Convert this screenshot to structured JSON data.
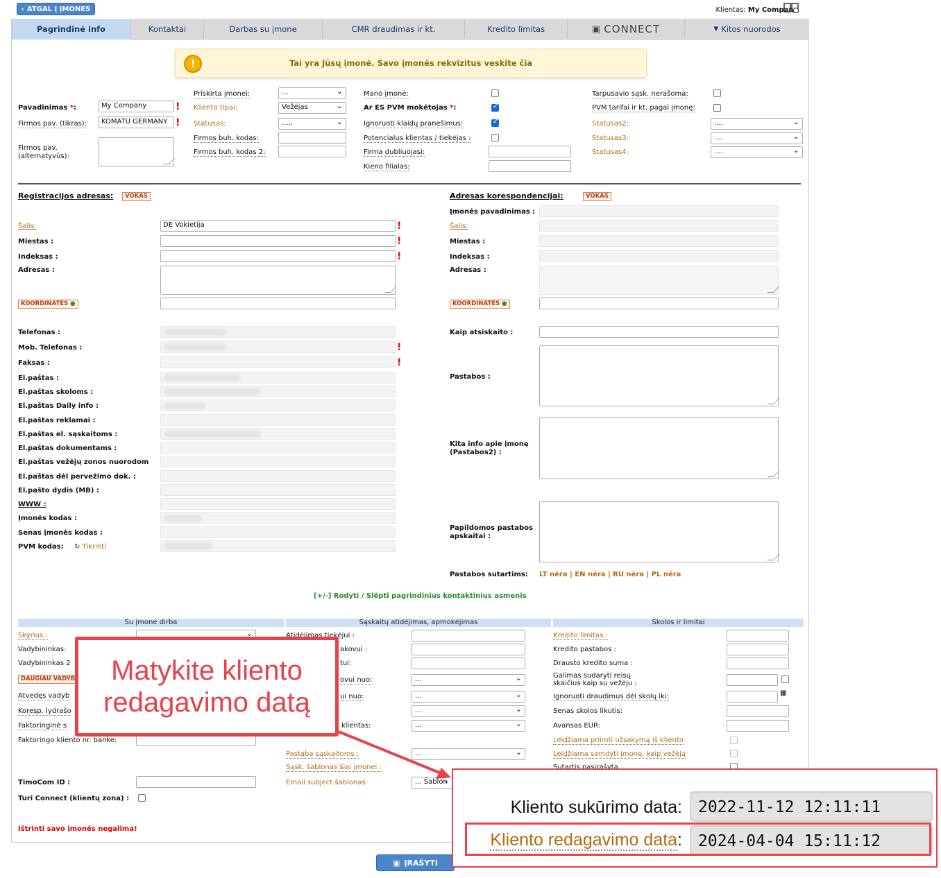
{
  "top": {
    "back_label": "ATGAL Į ĮMONES",
    "client_label": "Klientas:",
    "client_name": "My Company"
  },
  "tabs": [
    "Pagrindinė info",
    "Kontaktai",
    "Darbas su įmone",
    "CMR draudimas ir kt.",
    "Kredito limitas",
    "CONNECT",
    "Kitos nuorodos"
  ],
  "warning": "Tai yra Jūsų įmonė. Savo įmonės rekvizitus veskite čia",
  "main": {
    "pavadinimas_label": "Pavadinimas",
    "pavadinimas_value": "My Company",
    "firmos_label": "Firmos pav. (tikras):",
    "firmos_value": "KOMATU GERMANY",
    "firmos_alt_label": "Firmos pav. (alternatyvūs):",
    "priskirta_label": "Priskirta įmonei:",
    "priskirta_value": "...",
    "kliento_tipai_label": "Kliento tipai",
    "kliento_tipai_value": "Vežėjas",
    "statusas_label": "Statusas",
    "statusas_value": ".....",
    "buh_label": "Firmos buh. kodas:",
    "buh2_label": "Firmos buh. kodas 2:",
    "mano_label": "Mano įmonė:",
    "es_label": "Ar ES PVM mokėtojas",
    "ignoruoti_label": "Ignoruoti klaidų pranešimus:",
    "potencialus_label": "Potencialus klientas / tiekėjas :",
    "dubliuojasi_label": "Firma dubliuojasi:",
    "filialas_label": "Kieno filialas:",
    "tarpusavio_label": "Tarpusavio sąsk. nerašoma:",
    "pvm_tarifai_label": "PVM tarifai ir kt. pagal įmonę:",
    "statusas2_label": "Statusas2",
    "statusas3_label": "Statusas3",
    "statusas4_label": "Statusas4",
    "status_value": "...."
  },
  "reg": {
    "title": "Registracijos adresas:",
    "vokas": "VOKAS",
    "salis_label": "Šalis:",
    "salis_value": "DE Vokietija",
    "miestas_label": "Miestas :",
    "indeksas_label": "Indeksas :",
    "adresas_label": "Adresas :",
    "koord": "KOORDINATĖS",
    "telefonas": "Telefonas :",
    "mob": "Mob. Telefonas :",
    "faksas": "Faksas :",
    "el": "El.paštas :",
    "el_skol": "El.paštas skoloms :",
    "el_daily": "El.paštas Daily info :",
    "el_rekl": "El.paštas reklamai :",
    "el_sask": "El.paštas el. sąskaitoms :",
    "el_dok": "El.paštas dokumentams :",
    "el_vez": "El.paštas vežėjų zonos nuorodom",
    "el_perv": "El.paštas dėl pervežimo dok. :",
    "el_dydis": "El.pašto dydis (MB) :",
    "www": "WWW :",
    "kodas": "Įmonės kodas :",
    "senas": "Senas įmonės kodas :",
    "pvm": "PVM kodas:",
    "tikrinti": "Tikrinti"
  },
  "corr": {
    "title": "Adresas korespondencijai:",
    "vokas": "VOKAS",
    "pav": "Įmonės pavadinimas :",
    "salis": "Šalis:",
    "miestas": "Miestas :",
    "indeksas": "Indeksas :",
    "adresas": "Adresas :",
    "koord": "KOORDINATĖS",
    "atsiskaito": "Kaip atsiskaito :",
    "pastabos": "Pastabos :",
    "kita": "Kita info apie įmonę (Pastabos2) :",
    "papildomos": "Papildomos pastabos apskaitai :",
    "sutartims": "Pastabos sutartims:",
    "sut_lt": "LT nėra",
    "sut_en": "EN nėra",
    "sut_ru": "RU nėra",
    "sut_pl": "PL nėra"
  },
  "toggle_contacts": "[+/-] Rodyti / Slėpti pagrindinius kontaktinius asmenis",
  "sections": {
    "s1": "Su įmone dirba",
    "s2": "Sąskaitų atidėjimas, apmokėjimas",
    "s3": "Skolos ir limitai"
  },
  "col1": {
    "skyrius": "Skyrius",
    "vadybininkas": "Vadybininkas:",
    "vadybininkas2": "Vadybininkas 2",
    "daugiau": "DAUGIAU VADYB",
    "atvedes": "Atvedęs vadyb",
    "koresp": "Koresp. lydrašo",
    "faktoringine": "Faktoringinė s",
    "faktoringo": "Faktoringo kliento nr. banke:",
    "timocom": "TimoCom ID :",
    "connect": "Turi Connect (klientų zona) :",
    "delete": "Ištrinti savo įmonės negalima!"
  },
  "col2": {
    "atid": "Atidėjimas tiekėjui :",
    "pirk": "akovui :",
    "tui": "tui:",
    "nuo1": "ovui  nuo:",
    "nuo2": "ui  nuo:",
    "klientas": "klientas:",
    "pastaba": "Pastaba sąskaitoms",
    "sablonas": "Sąsk. šablonas šiai įmonei",
    "email": "Email subject šablonas:",
    "sel": "...",
    "email_value": "... Šablon"
  },
  "col3": {
    "kredito": "Kredito limitas",
    "pastabos": "Kredito pastabos :",
    "draud": "Drausto kredito suma :",
    "galimas": "Galimas sudaryti reisų skaičius kaip su vežėju :",
    "ignoruoti": "Ignoruoti draudimus dėl skolų iki:",
    "senas": "Senas skolos likutis:",
    "avansas": "Avansas EUR:",
    "leidz1": "Leidžiama priimti užsakymą iš kliento",
    "leidz2": "Leidžiama samdyti įmonę, kaip vežėją",
    "sutartis": "Sutartis pasirašyta"
  },
  "save_label": "ĮRAŠYTI",
  "callout": {
    "line1": "Matykite kliento",
    "line2": "redagavimo datą"
  },
  "zoom": {
    "created_label": "Kliento sukūrimo data",
    "created_value": "2022-11-12 12:11:11",
    "edited_label": "Kliento redagavimo data",
    "edited_value": "2024-04-04 15:11:12"
  },
  "colors": {
    "accent": "#4a86c8",
    "annotation": "#e7424a",
    "orange_label": "#b56a10"
  }
}
